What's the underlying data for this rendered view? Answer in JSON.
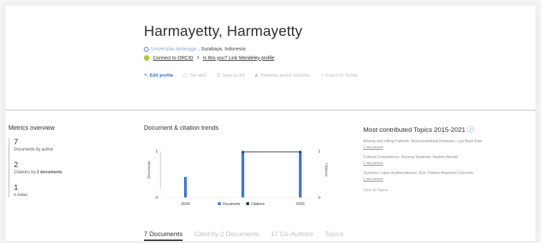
{
  "author": {
    "name": "Harmayetty, Harmayetty",
    "affiliation_link": "Universitas Airlangga",
    "affiliation_location": ", Surabaya, Indonesia",
    "orcid_label": "Connect to ORCID",
    "mendeley_label": "Is this you? Link Mendeley profile"
  },
  "actions": [
    {
      "label": "Edit profile",
      "icon": "pencil-icon"
    },
    {
      "label": "Set alert",
      "icon": "bell-icon"
    },
    {
      "label": "Save to list",
      "icon": "list-icon"
    },
    {
      "label": "Potential author matches",
      "icon": "people-icon"
    },
    {
      "label": "Export to SciVal",
      "icon": "export-icon"
    }
  ],
  "metrics": {
    "title": "Metrics overview",
    "items": [
      {
        "value": "7",
        "label": "Documents by author",
        "bold_part": ""
      },
      {
        "value": "2",
        "label": "Citations by ",
        "bold_part": "2 documents"
      },
      {
        "value": "1",
        "label": "h-index:",
        "bold_part": ""
      }
    ]
  },
  "trends": {
    "title": "Document & citation trends"
  },
  "chart_data": {
    "type": "bar",
    "title": "Document & citation trends",
    "ylabel": "Documents",
    "ylabel_right": "Citations",
    "x_tick_labels": [
      "2018",
      "2020"
    ],
    "ylim": [
      0,
      1
    ],
    "y_ticks": [
      "0",
      "1"
    ],
    "legend_position": "bottom",
    "series": [
      {
        "name": "Documents",
        "type": "bar",
        "color": "#3c78e0",
        "x": [
          2018,
          2019,
          2020
        ],
        "values": [
          0.45,
          1,
          1
        ]
      },
      {
        "name": "Citations",
        "type": "line",
        "color": "#1f2a44",
        "x": [
          2019,
          2020
        ],
        "values": [
          1,
          1
        ]
      }
    ]
  },
  "topics": {
    "title": "Most contributed Topics 2015-2021",
    "items": [
      {
        "title": "Moving and Lifting Patients; Musculoskeletal Diseases; Low Back Pain",
        "docs": "1 document"
      },
      {
        "title": "Cultural Competence; Nursing Students; Studies Abroad",
        "docs": "1 document"
      },
      {
        "title": "Systemic Lupus Erythematosus; SLE; Patient-Reported Outcome",
        "docs": "1 document"
      }
    ],
    "view_all": "View all Topics"
  },
  "tabs": [
    "7 Documents",
    "Cited by 2 Documents",
    "17 Co-Authors",
    "Topics"
  ],
  "colors": {
    "accent": "#2e6bd6",
    "orcid": "#a6ce39",
    "bar": "#3c78e0"
  }
}
